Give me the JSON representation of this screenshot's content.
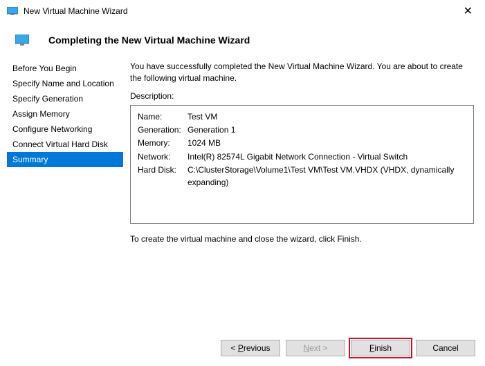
{
  "window": {
    "title": "New Virtual Machine Wizard"
  },
  "header": {
    "heading": "Completing the New Virtual Machine Wizard"
  },
  "sidebar": {
    "items": [
      {
        "label": "Before You Begin"
      },
      {
        "label": "Specify Name and Location"
      },
      {
        "label": "Specify Generation"
      },
      {
        "label": "Assign Memory"
      },
      {
        "label": "Configure Networking"
      },
      {
        "label": "Connect Virtual Hard Disk"
      },
      {
        "label": "Summary"
      }
    ]
  },
  "main": {
    "intro": "You have successfully completed the New Virtual Machine Wizard. You are about to create the following virtual machine.",
    "description_label": "Description:",
    "description": [
      {
        "key": "Name:",
        "value": "Test VM"
      },
      {
        "key": "Generation:",
        "value": "Generation 1"
      },
      {
        "key": "Memory:",
        "value": "1024 MB"
      },
      {
        "key": "Network:",
        "value": "Intel(R) 82574L Gigabit Network Connection - Virtual Switch"
      },
      {
        "key": "Hard Disk:",
        "value": "C:\\ClusterStorage\\Volume1\\Test VM\\Test VM.VHDX (VHDX, dynamically expanding)"
      }
    ],
    "hint": "To create the virtual machine and close the wizard, click Finish."
  },
  "footer": {
    "previous": "< Previous",
    "next": "Next >",
    "finish": "Finish",
    "cancel": "Cancel"
  }
}
